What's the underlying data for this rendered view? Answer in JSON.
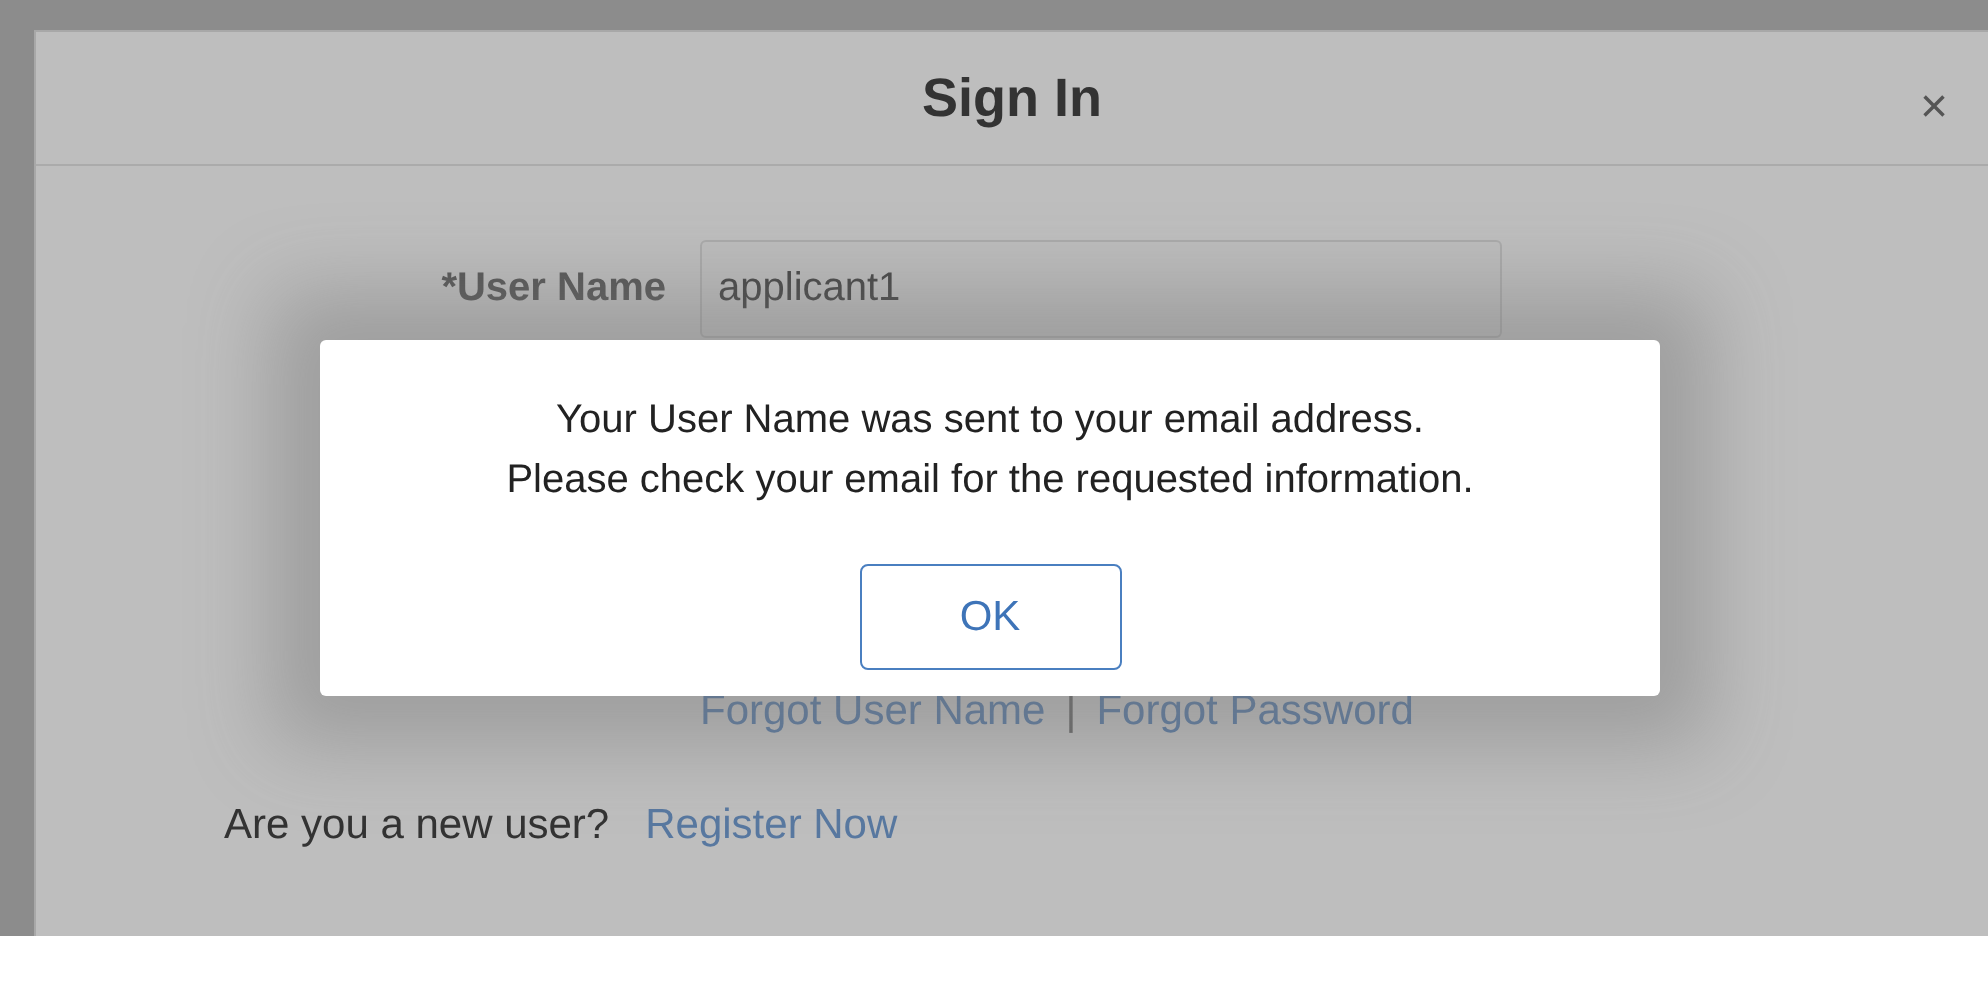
{
  "dialog": {
    "title": "Sign In",
    "close": "×"
  },
  "form": {
    "user_name_label": "*User Name",
    "user_name_value": "applicant1"
  },
  "links": {
    "forgot_user_name": "Forgot User Name",
    "separator": "|",
    "forgot_password": "Forgot Password"
  },
  "register": {
    "prompt": "Are you a new user?",
    "link": "Register Now"
  },
  "alert": {
    "lines": [
      "Your User Name was sent to your email address.",
      "Please check your email for the requested information."
    ],
    "button": "OK"
  }
}
